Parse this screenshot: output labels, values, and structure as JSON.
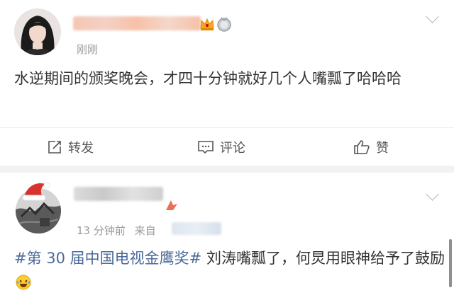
{
  "post1": {
    "author_name_redacted": true,
    "badges": [
      "crown-badge-icon",
      "medal-badge-icon"
    ],
    "time": "刚刚",
    "content": "水逆期间的颁奖晚会，才四十分钟就好几个人嘴瓢了哈哈哈",
    "actions": {
      "repost_label": "转发",
      "comment_label": "评论",
      "like_label": "赞"
    }
  },
  "post2": {
    "author_name_redacted": true,
    "time": "13 分钟前",
    "source_prefix": "来自",
    "topic": "#第 30 届中国电视金鹰奖#",
    "content": " 刘涛嘴瓢了，何炅用眼神给予了鼓励",
    "emoji": "laughing-crying-emoji-icon"
  },
  "colors": {
    "topic_link": "#4b6a9a",
    "text": "#333333",
    "meta": "#9b9b9b",
    "divider": "#f2f2f2"
  }
}
